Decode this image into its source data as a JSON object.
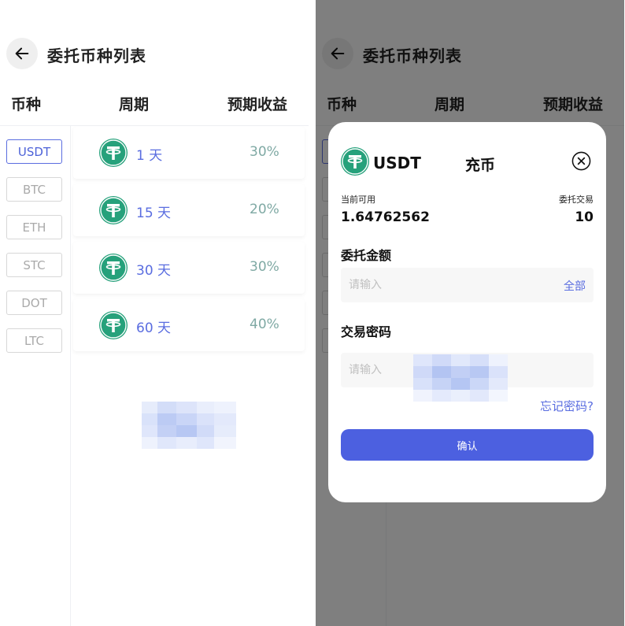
{
  "header": {
    "title": "委托币种列表"
  },
  "columns": {
    "coin": "币种",
    "period": "周期",
    "yield": "预期收益"
  },
  "coins": [
    "USDT",
    "BTC",
    "ETH",
    "STC",
    "DOT",
    "LTC"
  ],
  "selected_coin": "USDT",
  "plans": [
    {
      "period": "1 天",
      "rate": "30%"
    },
    {
      "period": "15 天",
      "rate": "20%"
    },
    {
      "period": "30 天",
      "rate": "30%"
    },
    {
      "period": "60 天",
      "rate": "40%"
    }
  ],
  "modal": {
    "coin": "USDT",
    "title": "充币",
    "available_label": "当前可用",
    "available_value": "1.64762562",
    "trades_label": "委托交易",
    "trades_value": "10",
    "amount_label": "委托金额",
    "amount_placeholder": "请输入",
    "all_label": "全部",
    "password_label": "交易密码",
    "password_placeholder": "请输入",
    "forgot_label": "忘记密码?",
    "confirm_label": "确认"
  },
  "colors": {
    "accent": "#4c60e0",
    "tether": "#26a17b",
    "rate": "#7fa9a4",
    "overlay": "rgba(0,0,0,0.5)"
  },
  "icons": {
    "back": "arrow-left-icon",
    "coin": "tether-icon",
    "close": "close-circle-icon"
  }
}
